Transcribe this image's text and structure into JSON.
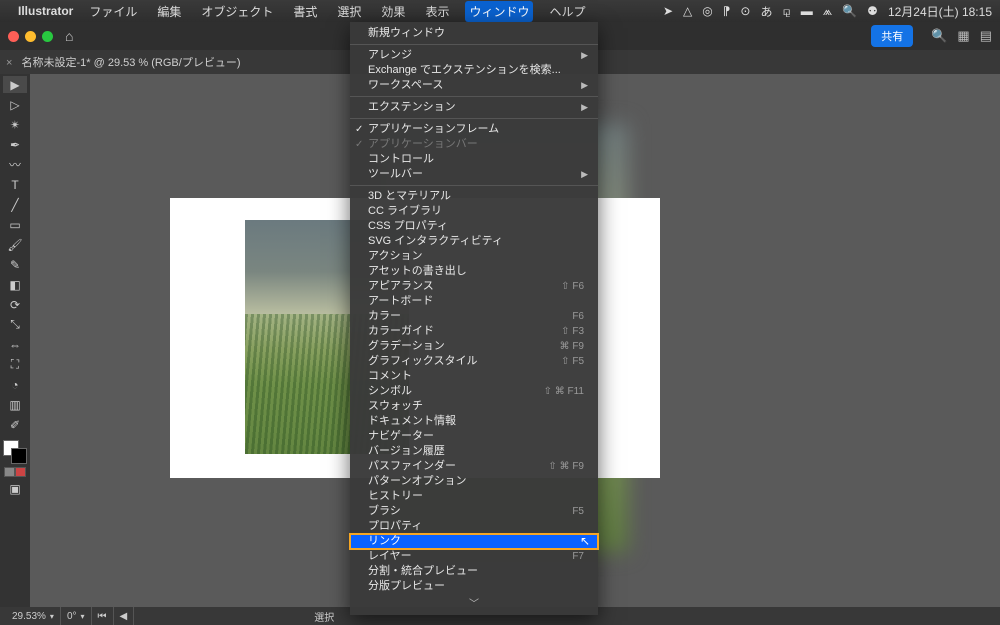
{
  "menubar": {
    "app": "Illustrator",
    "items": [
      "ファイル",
      "編集",
      "オブジェクト",
      "書式",
      "選択",
      "効果",
      "表示",
      "ウィンドウ",
      "ヘルプ"
    ],
    "active_index": 7,
    "clock": "12月24日(土)  18:15"
  },
  "app_top": {
    "share": "共有"
  },
  "doc_tab": {
    "title": "名称未設定-1* @ 29.53 % (RGB/プレビュー)"
  },
  "dropdown": {
    "new_window": "新規ウィンドウ",
    "arrange": "アレンジ",
    "exchange": "Exchange でエクステンションを検索...",
    "workspace": "ワークスペース",
    "extension": "エクステンション",
    "app_frame": "アプリケーションフレーム",
    "app_bar": "アプリケーションバー",
    "control": "コントロール",
    "toolbar": "ツールバー",
    "threed": "3D とマテリアル",
    "cc_lib": "CC ライブラリ",
    "css_prop": "CSS プロパティ",
    "svg_int": "SVG インタラクティビティ",
    "action": "アクション",
    "asset_export": "アセットの書き出し",
    "appearance": "アピアランス",
    "appearance_sc": "⇧ F6",
    "artboard": "アートボード",
    "color": "カラー",
    "color_sc": "F6",
    "color_guide": "カラーガイド",
    "color_guide_sc": "⇧ F3",
    "gradation": "グラデーション",
    "gradation_sc": "⌘ F9",
    "graphic_style": "グラフィックスタイル",
    "graphic_style_sc": "⇧ F5",
    "comment": "コメント",
    "symbol": "シンボル",
    "symbol_sc": "⇧ ⌘ F11",
    "swatch": "スウォッチ",
    "doc_info": "ドキュメント情報",
    "navigator": "ナビゲーター",
    "version": "バージョン履歴",
    "pathfinder": "パスファインダー",
    "pathfinder_sc": "⇧ ⌘ F9",
    "pattern_opt": "パターンオプション",
    "history": "ヒストリー",
    "brush": "ブラシ",
    "brush_sc": "F5",
    "property": "プロパティ",
    "link": "リンク",
    "layer": "レイヤー",
    "layer_sc": "F7",
    "split_preview": "分割・統合プレビュー",
    "sep_preview": "分版プレビュー"
  },
  "status": {
    "zoom": "29.53%",
    "rotate": "0°",
    "selection": "選択"
  }
}
